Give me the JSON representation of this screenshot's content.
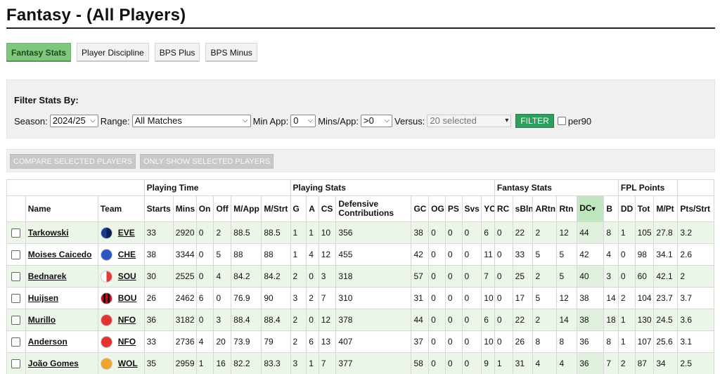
{
  "page": {
    "title": "Fantasy - (All Players)"
  },
  "tabs": [
    {
      "label": "Fantasy Stats",
      "active": true
    },
    {
      "label": "Player Discipline",
      "active": false
    },
    {
      "label": "BPS Plus",
      "active": false
    },
    {
      "label": "BPS Minus",
      "active": false
    }
  ],
  "filters": {
    "heading": "Filter Stats By:",
    "season_label": "Season:",
    "season_value": "2024/25",
    "range_label": "Range:",
    "range_value": "All Matches",
    "minapp_label": "Min App:",
    "minapp_value": "0",
    "minsapp_label": "Mins/App:",
    "minsapp_value": ">0",
    "versus_label": "Versus:",
    "versus_value": "20 selected",
    "filter_button": "FILTER",
    "per90_label": "per90"
  },
  "actions": {
    "compare": "COMPARE SELECTED PLAYERS",
    "only_show": "ONLY SHOW SELECTED PLAYERS"
  },
  "table": {
    "groups": {
      "playing_time": "Playing Time",
      "playing_stats": "Playing Stats",
      "fantasy_stats": "Fantasy Stats",
      "fpl_points": "FPL Points"
    },
    "columns": [
      "",
      "Name",
      "Team",
      "Starts",
      "Mins",
      "On",
      "Off",
      "M/App",
      "M/Strt",
      "G",
      "A",
      "CS",
      "Defensive Contributions",
      "GC",
      "OG",
      "PS",
      "Svs",
      "YC",
      "RC",
      "sBln",
      "ARtn",
      "Rtn",
      "DC",
      "B",
      "DD",
      "Tot",
      "M/Pt",
      "Pts/Strt"
    ],
    "sort_indicator": "▾",
    "rows": [
      {
        "name": "Tarkowski",
        "team": "EVE",
        "badge": "eve",
        "cells": [
          "33",
          "2920",
          "0",
          "2",
          "88.5",
          "88.5",
          "1",
          "1",
          "10",
          "356",
          "38",
          "0",
          "0",
          "0",
          "6",
          "0",
          "22",
          "2",
          "12",
          "44",
          "8",
          "1",
          "105",
          "27.8",
          "3.2"
        ]
      },
      {
        "name": "Moises Caicedo",
        "team": "CHE",
        "badge": "che",
        "cells": [
          "38",
          "3344",
          "0",
          "5",
          "88",
          "88",
          "1",
          "4",
          "12",
          "455",
          "42",
          "0",
          "0",
          "0",
          "11",
          "0",
          "33",
          "5",
          "5",
          "42",
          "4",
          "0",
          "98",
          "34.1",
          "2.6"
        ]
      },
      {
        "name": "Bednarek",
        "team": "SOU",
        "badge": "sou",
        "cells": [
          "30",
          "2525",
          "0",
          "4",
          "84.2",
          "84.2",
          "2",
          "0",
          "3",
          "318",
          "57",
          "0",
          "0",
          "0",
          "7",
          "0",
          "25",
          "2",
          "5",
          "40",
          "3",
          "0",
          "60",
          "42.1",
          "2"
        ]
      },
      {
        "name": "Huijsen",
        "team": "BOU",
        "badge": "bou",
        "cells": [
          "26",
          "2462",
          "6",
          "0",
          "76.9",
          "90",
          "3",
          "2",
          "7",
          "310",
          "31",
          "0",
          "0",
          "0",
          "10",
          "0",
          "17",
          "5",
          "12",
          "38",
          "14",
          "2",
          "104",
          "23.7",
          "3.7"
        ]
      },
      {
        "name": "Murillo",
        "team": "NFO",
        "badge": "nfo",
        "cells": [
          "36",
          "3182",
          "0",
          "3",
          "88.4",
          "88.4",
          "2",
          "0",
          "12",
          "378",
          "44",
          "0",
          "0",
          "0",
          "6",
          "0",
          "22",
          "2",
          "14",
          "38",
          "18",
          "1",
          "130",
          "24.5",
          "3.6"
        ]
      },
      {
        "name": "Anderson",
        "team": "NFO",
        "badge": "nfo",
        "cells": [
          "33",
          "2736",
          "4",
          "20",
          "73.9",
          "79",
          "2",
          "6",
          "13",
          "407",
          "37",
          "0",
          "0",
          "0",
          "10",
          "0",
          "26",
          "8",
          "8",
          "36",
          "8",
          "1",
          "107",
          "25.6",
          "3.1"
        ]
      },
      {
        "name": "João Gomes",
        "team": "WOL",
        "badge": "wol",
        "cells": [
          "35",
          "2959",
          "1",
          "16",
          "82.2",
          "83.3",
          "3",
          "1",
          "7",
          "377",
          "58",
          "0",
          "0",
          "0",
          "9",
          "1",
          "31",
          "4",
          "4",
          "36",
          "7",
          "2",
          "87",
          "34",
          "2.5"
        ]
      }
    ]
  },
  "colors": {
    "active_tab": "#7fc77f",
    "filter_button": "#2e9e5c",
    "row_green": "#ebf6e9",
    "sorted_header": "#bfe6bf",
    "eve": "#1b3a8c",
    "che": "#2b55c6",
    "sou": "#e03a3e",
    "bou": "#b5121b",
    "nfo": "#e53233",
    "wol": "#f2a32a"
  }
}
